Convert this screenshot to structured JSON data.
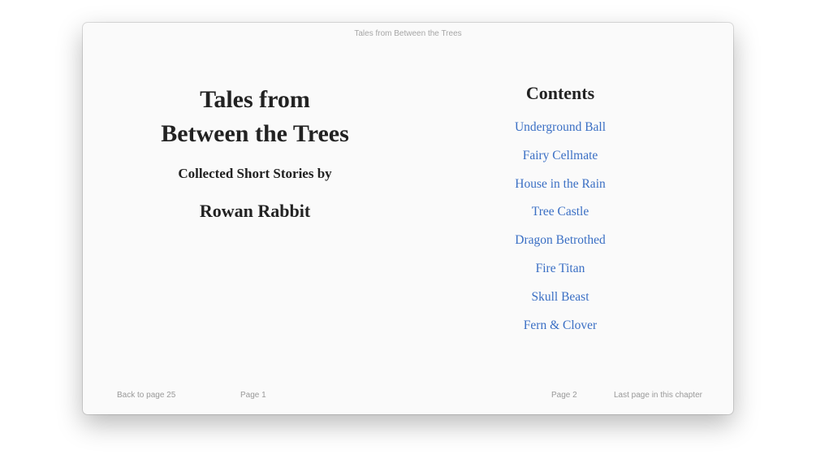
{
  "window": {
    "title": "Tales from Between the Trees"
  },
  "left_page": {
    "title_line1": "Tales from",
    "title_line2": "Between the Trees",
    "subtitle": "Collected Short Stories by",
    "author": "Rowan Rabbit",
    "footer_back": "Back to page 25",
    "page_label": "Page 1"
  },
  "right_page": {
    "heading": "Contents",
    "chapters": [
      "Underground Ball",
      "Fairy Cellmate",
      "House in the Rain",
      "Tree Castle",
      "Dragon Betrothed",
      "Fire Titan",
      "Skull Beast",
      "Fern & Clover"
    ],
    "page_label": "Page 2",
    "footer_last": "Last page in this chapter"
  },
  "colors": {
    "link": "#3a6fc4",
    "text": "#222222",
    "muted": "#999999",
    "page_bg": "#fafafa"
  }
}
